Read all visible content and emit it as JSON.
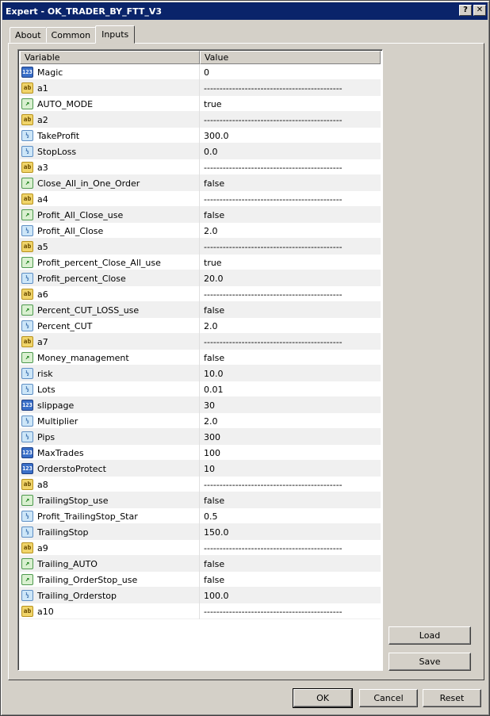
{
  "window": {
    "title": "Expert - OK_TRADER_BY_FTT_V3"
  },
  "title_buttons": {
    "help": "?",
    "close": "✕"
  },
  "tabs": [
    "About",
    "Common",
    "Inputs"
  ],
  "grid": {
    "headers": {
      "variable": "Variable",
      "value": "Value"
    },
    "rows": [
      {
        "type": "int",
        "name": "Magic",
        "value": "0"
      },
      {
        "type": "str",
        "name": "a1",
        "value": "--------------------------------------------"
      },
      {
        "type": "bool",
        "name": "AUTO_MODE",
        "value": "true"
      },
      {
        "type": "str",
        "name": "a2",
        "value": "--------------------------------------------"
      },
      {
        "type": "dbl",
        "name": "TakeProfit",
        "value": "300.0"
      },
      {
        "type": "dbl",
        "name": "StopLoss",
        "value": "0.0"
      },
      {
        "type": "str",
        "name": "a3",
        "value": "--------------------------------------------"
      },
      {
        "type": "bool",
        "name": "Close_All_in_One_Order",
        "value": "false"
      },
      {
        "type": "str",
        "name": "a4",
        "value": "--------------------------------------------"
      },
      {
        "type": "bool",
        "name": "Profit_All_Close_use",
        "value": "false"
      },
      {
        "type": "dbl",
        "name": "Profit_All_Close",
        "value": "2.0"
      },
      {
        "type": "str",
        "name": "a5",
        "value": "--------------------------------------------"
      },
      {
        "type": "bool",
        "name": "Profit_percent_Close_All_use",
        "value": "true"
      },
      {
        "type": "dbl",
        "name": "Profit_percent_Close",
        "value": "20.0"
      },
      {
        "type": "str",
        "name": "a6",
        "value": "--------------------------------------------"
      },
      {
        "type": "bool",
        "name": "Percent_CUT_LOSS_use",
        "value": "false"
      },
      {
        "type": "dbl",
        "name": "Percent_CUT",
        "value": "2.0"
      },
      {
        "type": "str",
        "name": "a7",
        "value": "--------------------------------------------"
      },
      {
        "type": "bool",
        "name": "Money_management",
        "value": "false"
      },
      {
        "type": "dbl",
        "name": "risk",
        "value": "10.0"
      },
      {
        "type": "dbl",
        "name": "Lots",
        "value": "0.01"
      },
      {
        "type": "int",
        "name": "slippage",
        "value": "30"
      },
      {
        "type": "dbl",
        "name": "Multiplier",
        "value": "2.0"
      },
      {
        "type": "dbl",
        "name": "Pips",
        "value": "300"
      },
      {
        "type": "int",
        "name": "MaxTrades",
        "value": "100"
      },
      {
        "type": "int",
        "name": "OrderstoProtect",
        "value": "10"
      },
      {
        "type": "str",
        "name": "a8",
        "value": "--------------------------------------------"
      },
      {
        "type": "bool",
        "name": "TrailingStop_use",
        "value": "false"
      },
      {
        "type": "dbl",
        "name": "Profit_TrailingStop_Star",
        "value": "0.5"
      },
      {
        "type": "dbl",
        "name": "TrailingStop",
        "value": "150.0"
      },
      {
        "type": "str",
        "name": "a9",
        "value": "--------------------------------------------"
      },
      {
        "type": "bool",
        "name": "Trailing_AUTO",
        "value": "false"
      },
      {
        "type": "bool",
        "name": "Trailing_OrderStop_use",
        "value": "false"
      },
      {
        "type": "dbl",
        "name": "Trailing_Orderstop",
        "value": "100.0"
      },
      {
        "type": "str",
        "name": "a10",
        "value": "--------------------------------------------"
      }
    ]
  },
  "icons": {
    "int": {
      "name": "integer-type-icon",
      "glyph": "123"
    },
    "str": {
      "name": "string-type-icon",
      "glyph": "ab"
    },
    "bool": {
      "name": "boolean-type-icon",
      "glyph": "↗"
    },
    "dbl": {
      "name": "double-type-icon",
      "glyph": "½"
    }
  },
  "buttons": {
    "load": "Load",
    "save": "Save",
    "ok": "OK",
    "cancel": "Cancel",
    "reset": "Reset"
  }
}
